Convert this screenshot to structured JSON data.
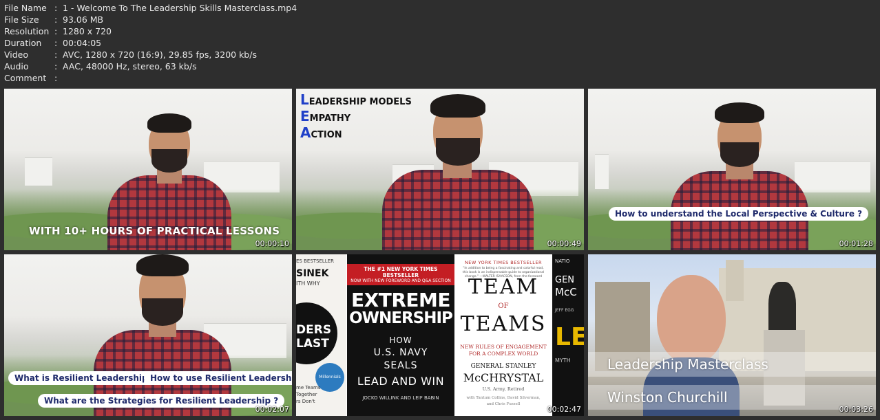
{
  "file_info": {
    "rows": [
      {
        "key": "File Name",
        "value": "1 - Welcome To The Leadership Skills Masterclass.mp4"
      },
      {
        "key": "File Size",
        "value": "93.06 MB"
      },
      {
        "key": "Resolution",
        "value": "1280 x 720"
      },
      {
        "key": "Duration",
        "value": "00:04:05"
      },
      {
        "key": "Video",
        "value": "AVC, 1280 x 720 (16:9), 29.85 fps, 3200 kb/s"
      },
      {
        "key": "Audio",
        "value": "AAC, 48000 Hz, stereo, 63 kb/s"
      },
      {
        "key": "Comment",
        "value": ""
      }
    ],
    "separator": ":"
  },
  "thumbnails": [
    {
      "timestamp": "00:00:10",
      "caption": "WITH 10+ HOURS OF PRACTICAL LESSONS"
    },
    {
      "timestamp": "00:00:49",
      "lea": [
        {
          "initial": "L",
          "rest": "EADERSHIP MODELS"
        },
        {
          "initial": "E",
          "rest": "MPATHY"
        },
        {
          "initial": "A",
          "rest": "CTION"
        }
      ]
    },
    {
      "timestamp": "00:01:28",
      "pill": "How to understand the Local Perspective & Culture ?"
    },
    {
      "timestamp": "00:02:07",
      "pills": [
        "What is Resilient Leadership ?",
        "How to use Resilient Leadership ?",
        "What are the Strategies for Resilient Leadership ?"
      ]
    },
    {
      "timestamp": "00:02:47",
      "books": {
        "b1": {
          "top": "ES BESTSELLER",
          "author": "SINEK",
          "sub": "ITH WHY",
          "mid1": "DERS",
          "mid2": "LAST",
          "side": "Millennials",
          "bottom1": "me Teams",
          "bottom2": "Together",
          "bottom3": "rs Don't"
        },
        "b2": {
          "banner1": "THE #1 NEW YORK TIMES BESTSELLER",
          "banner2": "NOW WITH NEW FOREWORD AND Q&A SECTION",
          "title1": "EXTREME",
          "title2": "OWNERSHIP",
          "sub1": "HOW",
          "sub2": "U.S. NAVY",
          "sub3": "SEALS",
          "sub4": "LEAD AND WIN",
          "authors": "JOCKO WILLINK AND LEIF BABIN"
        },
        "b3": {
          "top": "NEW YORK TIMES BESTSELLER",
          "quote": "\"In addition to being a fascinating and colorful read, this book is an indispensable guide to organizational change.\" —WALTER ISAACSON, from the foreword",
          "title1": "TEAM",
          "of": "OF",
          "title2": "TEAMS",
          "sub1": "NEW RULES OF ENGAGEMENT",
          "sub2": "FOR A COMPLEX WORLD",
          "author1": "GENERAL STANLEY",
          "author2": "McCHRYSTAL",
          "rank": "U.S. Army, Retired",
          "with1": "with Tantum Collins, David Silverman,",
          "with2": "and Chris Fussell"
        },
        "b4": {
          "top": "NATIO",
          "a1": "GEN",
          "a2": "McC",
          "a3": "JEFF EGG",
          "big": "LE",
          "bottom": "MYTH"
        }
      }
    },
    {
      "timestamp": "00:03:26",
      "overlay1": "Leadership Masterclass",
      "overlay2": "Winston Churchill"
    }
  ]
}
